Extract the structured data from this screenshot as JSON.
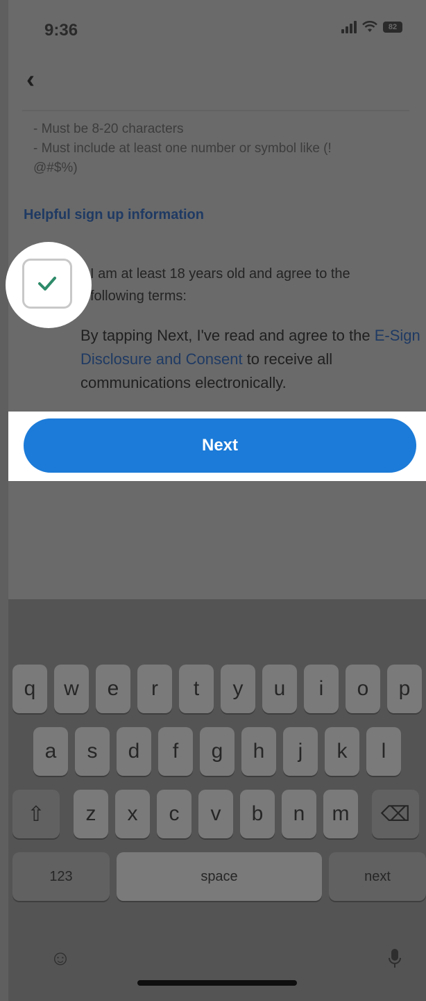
{
  "status_bar": {
    "time": "9:36",
    "battery": "82"
  },
  "form": {
    "password_rules": [
      "- Must be 8-20 characters",
      "- Must include at least one number or symbol like (!",
      "@#$%)"
    ],
    "helpful_link": "Helpful sign up information",
    "age_agreement": "I am at least 18 years old and agree to the following terms:",
    "consent_prefix": "By tapping Next, I've read and agree to the ",
    "consent_link": "E-Sign Disclosure and Consent",
    "consent_suffix": " to receive all communications electronically.",
    "checkbox_checked": true,
    "next_label": "Next"
  },
  "keyboard": {
    "row1": [
      "q",
      "w",
      "e",
      "r",
      "t",
      "y",
      "u",
      "i",
      "o",
      "p"
    ],
    "row2": [
      "a",
      "s",
      "d",
      "f",
      "g",
      "h",
      "j",
      "k",
      "l"
    ],
    "row3": [
      "z",
      "x",
      "c",
      "v",
      "b",
      "n",
      "m"
    ],
    "numbers_label": "123",
    "space_label": "space",
    "next_key_label": "next"
  },
  "colors": {
    "accent": "#1c7bd8",
    "link": "#1f3a63",
    "check": "#2e8b6a"
  }
}
